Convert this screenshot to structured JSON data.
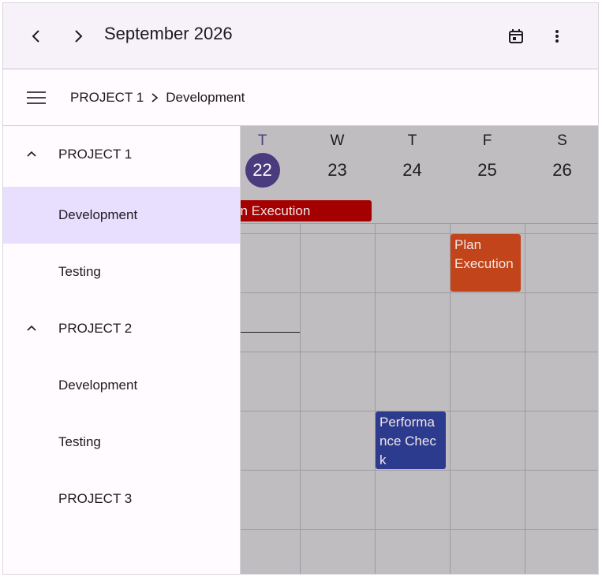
{
  "header": {
    "title": "September 2026",
    "prev_icon": "chevron-left-icon",
    "next_icon": "chevron-right-icon",
    "calendar_icon": "calendar-today-icon",
    "more_icon": "more-vert-icon",
    "background": "#f7f2fa"
  },
  "breadcrumb": {
    "menu_icon": "hamburger-menu-icon",
    "items": [
      "PROJECT 1",
      "Development"
    ],
    "separator_icon": "chevron-right-icon"
  },
  "calendar": {
    "days": [
      {
        "letter": "T",
        "number": "22",
        "today": true
      },
      {
        "letter": "W",
        "number": "23",
        "today": false
      },
      {
        "letter": "T",
        "number": "24",
        "today": false
      },
      {
        "letter": "F",
        "number": "25",
        "today": false
      },
      {
        "letter": "S",
        "number": "26",
        "today": false
      }
    ],
    "events": [
      {
        "title": "an Execution",
        "color": "#a50000",
        "kind": "all-day"
      },
      {
        "title": "Plan Execution",
        "color": "#c1441a",
        "kind": "timed"
      },
      {
        "title": "Performance Check",
        "color": "#2d3b8f",
        "kind": "timed"
      }
    ],
    "today_color": "#4a3a7e",
    "grid_background": "#bfbdbf"
  },
  "drawer": {
    "items": [
      {
        "label": "PROJECT 1",
        "level": 0,
        "expanded": true,
        "selected": false
      },
      {
        "label": "Development",
        "level": 1,
        "selected": true
      },
      {
        "label": "Testing",
        "level": 1,
        "selected": false
      },
      {
        "label": "PROJECT 2",
        "level": 0,
        "expanded": true,
        "selected": false
      },
      {
        "label": "Development",
        "level": 1,
        "selected": false
      },
      {
        "label": "Testing",
        "level": 1,
        "selected": false
      },
      {
        "label": "PROJECT 3",
        "level": 0,
        "expanded": false,
        "selected": false
      }
    ],
    "selected_color": "#e8defe"
  }
}
